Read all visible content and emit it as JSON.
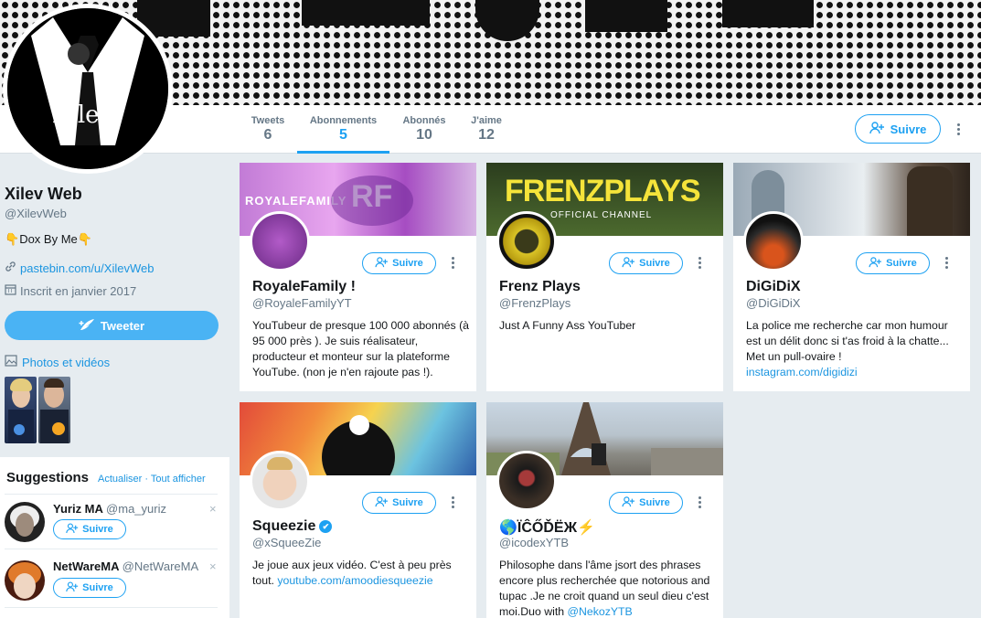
{
  "profile": {
    "name": "Xilev Web",
    "handle": "@XilevWeb",
    "avatar_text": "Xilev",
    "bio_prefix_emoji": "👇",
    "bio": "Dox By Me",
    "bio_suffix_emoji": "👇",
    "url": "pastebin.com/u/XilevWeb",
    "joined": "Inscrit en janvier 2017",
    "tweet_button": "Tweeter",
    "photos_link": "Photos et vidéos"
  },
  "nav": {
    "tabs": [
      {
        "label": "Tweets",
        "value": "6"
      },
      {
        "label": "Abonnements",
        "value": "5"
      },
      {
        "label": "Abonnés",
        "value": "10"
      },
      {
        "label": "J'aime",
        "value": "12"
      }
    ],
    "follow_button": "Suivre"
  },
  "suggestions": {
    "title": "Suggestions",
    "refresh": "Actualiser",
    "separator": "·",
    "view_all": "Tout afficher",
    "items": [
      {
        "name": "Yuriz MA",
        "handle": "@ma_yuriz",
        "follow": "Suivre",
        "dismiss": "×"
      },
      {
        "name": "NetWareMA",
        "handle": "@NetWareMA",
        "follow": "Suivre",
        "dismiss": "×"
      }
    ]
  },
  "cards": [
    {
      "name": "RoyaleFamily !",
      "handle": "@RoyaleFamilyYT",
      "follow": "Suivre",
      "bio": "YouTubeur de presque 100 000 abonnés (à 95 000 près ). Je suis réalisateur, producteur et monteur sur la plateforme YouTube. (non je n'en rajoute pas !).",
      "banner_text": "ROYALEFAMILY",
      "banner_initials": "RF"
    },
    {
      "name": "Frenz Plays",
      "handle": "@FrenzPlays",
      "follow": "Suivre",
      "bio": "Just A Funny Ass YouTuber",
      "banner_text": "FRENZPLAYS",
      "banner_sub": "OFFICIAL CHANNEL"
    },
    {
      "name": "DiGiDiX",
      "handle": "@DiGiDiX",
      "follow": "Suivre",
      "bio": "La police me recherche car mon humour est un délit donc si t'as froid à la chatte... Met un pull-ovaire !",
      "link": "instagram.com/digidizi"
    },
    {
      "name": "Squeezie",
      "handle": "@xSqueeZie",
      "follow": "Suivre",
      "bio": "Je joue aux jeux vidéo. C'est à peu près tout.",
      "link": "youtube.com/amoodiesqueezie",
      "verified": true
    },
    {
      "name": "🌎ÏĈŐĎЁЖ⚡",
      "handle": "@icodexYTB",
      "follow": "Suivre",
      "bio": "Philosophe dans l'âme jsort des phrases encore plus recherchée que notorious and tupac .Je ne croit quand un seul dieu c'est moi.Duo with",
      "link": "@NekozYTB"
    }
  ],
  "colors": {
    "accent": "#1da1f2",
    "link": "#1b95e0",
    "muted": "#657786",
    "background": "#e6ecf0"
  }
}
